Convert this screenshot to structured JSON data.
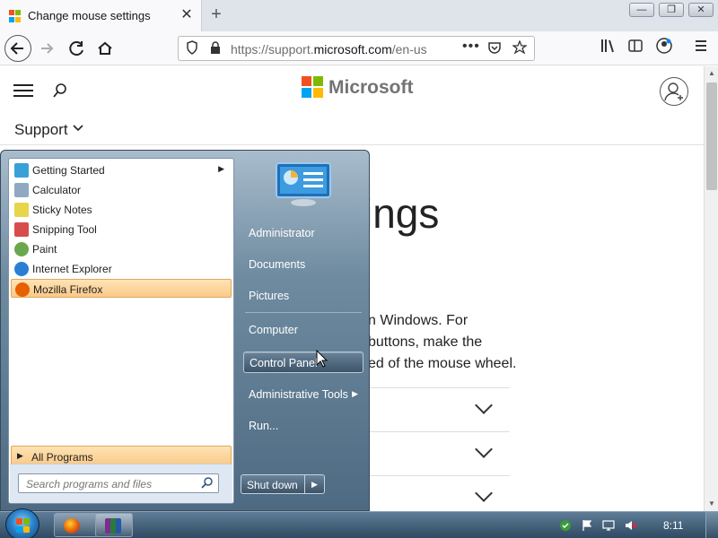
{
  "browser": {
    "tab_title": "Change mouse settings",
    "tab_close": "✕",
    "new_tab": "+",
    "url_prefix": "https://support.",
    "url_domain": "microsoft.com",
    "url_suffix": "/en-us",
    "window_buttons": {
      "minimize": "—",
      "maximize": "❐",
      "close": "✕"
    }
  },
  "page": {
    "brand": "Microsoft",
    "support_label": "Support",
    "title_fragment": "ings",
    "body_lines": [
      "n Windows. For",
      "buttons, make the",
      "ed of the mouse wheel."
    ],
    "accordion_rows": 3
  },
  "start_menu": {
    "programs": [
      {
        "label": "Getting Started",
        "icon": "getting-started-icon",
        "color": "#3aa0d8",
        "has_submenu": true
      },
      {
        "label": "Calculator",
        "icon": "calculator-icon",
        "color": "#8fa9c2"
      },
      {
        "label": "Sticky Notes",
        "icon": "sticky-notes-icon",
        "color": "#e8d54a"
      },
      {
        "label": "Snipping Tool",
        "icon": "snipping-tool-icon",
        "color": "#d84c4c"
      },
      {
        "label": "Paint",
        "icon": "paint-icon",
        "color": "#6aa84f"
      },
      {
        "label": "Internet Explorer",
        "icon": "internet-explorer-icon",
        "color": "#2a7fd4"
      },
      {
        "label": "Mozilla Firefox",
        "icon": "firefox-icon",
        "color": "#e66000",
        "highlighted": true
      }
    ],
    "all_programs": "All Programs",
    "search_placeholder": "Search programs and files",
    "right_items": [
      {
        "label": "Administrator"
      },
      {
        "label": "Documents"
      },
      {
        "label": "Pictures"
      },
      {
        "label": "Computer"
      },
      {
        "label": "Control Panel",
        "highlighted": true
      },
      {
        "label": "Administrative Tools",
        "has_submenu": true
      },
      {
        "label": "Run..."
      }
    ],
    "shutdown_label": "Shut down"
  },
  "taskbar": {
    "clock": "8:11"
  },
  "colors": {
    "ms_red": "#f25022",
    "ms_green": "#7fba00",
    "ms_blue": "#00a4ef",
    "ms_yellow": "#ffb900"
  }
}
